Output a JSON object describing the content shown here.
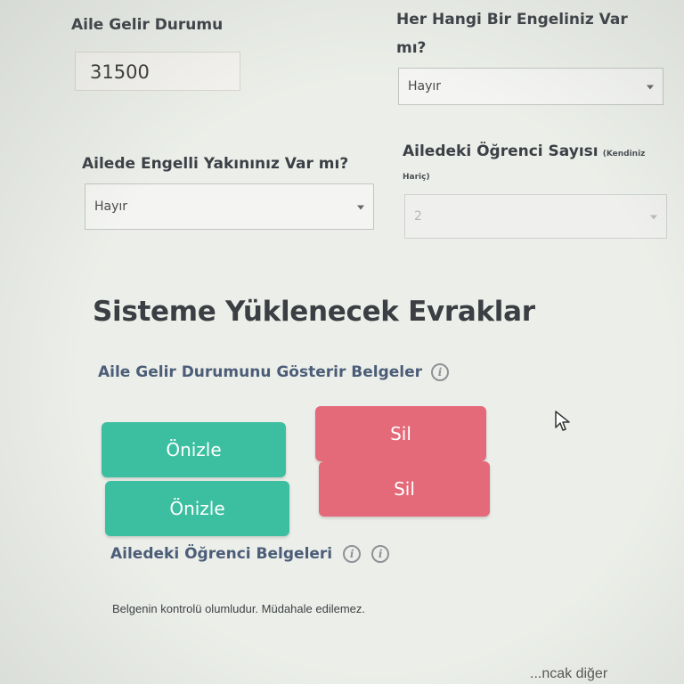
{
  "form": {
    "income_label": "Aile Gelir Durumu",
    "income_value": "31500",
    "disability_label_line1": "Her Hangi Bir Engeliniz Var",
    "disability_label_line2": "mı?",
    "disability_value": "Hayır",
    "family_disabled_label": "Ailede Engelli Yakınınız Var mı?",
    "family_disabled_value": "Hayır",
    "student_count_label": "Ailedeki Öğrenci Sayısı",
    "student_count_note_1": "(Kendiniz",
    "student_count_note_2": "Hariç)",
    "student_count_value": "2"
  },
  "documents": {
    "title": "Sisteme Yüklenecek Evraklar",
    "income_docs_label": "Aile Gelir Durumunu Gösterir Belgeler",
    "preview_label": "Önizle",
    "delete_label": "Sil",
    "student_docs_label": "Ailedeki Öğrenci Belgeleri",
    "status_text": "Belgenin kontrolü olumludur. Müdahale edilemez.",
    "cut_off_text": "...ncak diğer"
  },
  "icons": {
    "info": "info-icon",
    "cursor": "mouse-pointer-icon",
    "caret": "chevron-down-icon"
  },
  "colors": {
    "preview_button": "#3bbfa0",
    "delete_button": "#e46a79",
    "subtitle": "#4b5d78"
  }
}
